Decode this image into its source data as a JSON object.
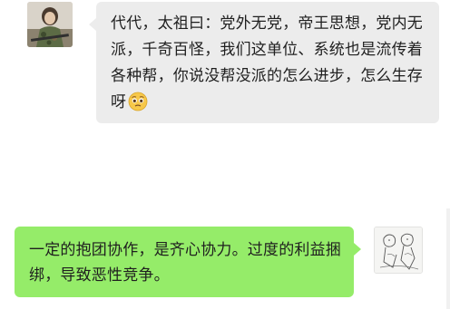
{
  "messages": [
    {
      "direction": "incoming",
      "text": "代代，太祖曰：党外无党，帝王思想，党内无派，千奇百怪，我们这单位、系统也是流传着各种帮，你说没帮没派的怎么进步，怎么生存呀",
      "emoji": "pleading-face-emoji",
      "avatar_icon": "camouflage-person-avatar"
    },
    {
      "direction": "outgoing",
      "text": "一定的抱团协作，是齐心协力。过度的利益捆绑，导致恶性竞争。",
      "avatar_icon": "ink-sketch-avatar"
    }
  ],
  "colors": {
    "background": "#ffffff",
    "incoming_bubble": "#ececec",
    "outgoing_bubble": "#95ec69",
    "text": "#1f1f1f"
  }
}
